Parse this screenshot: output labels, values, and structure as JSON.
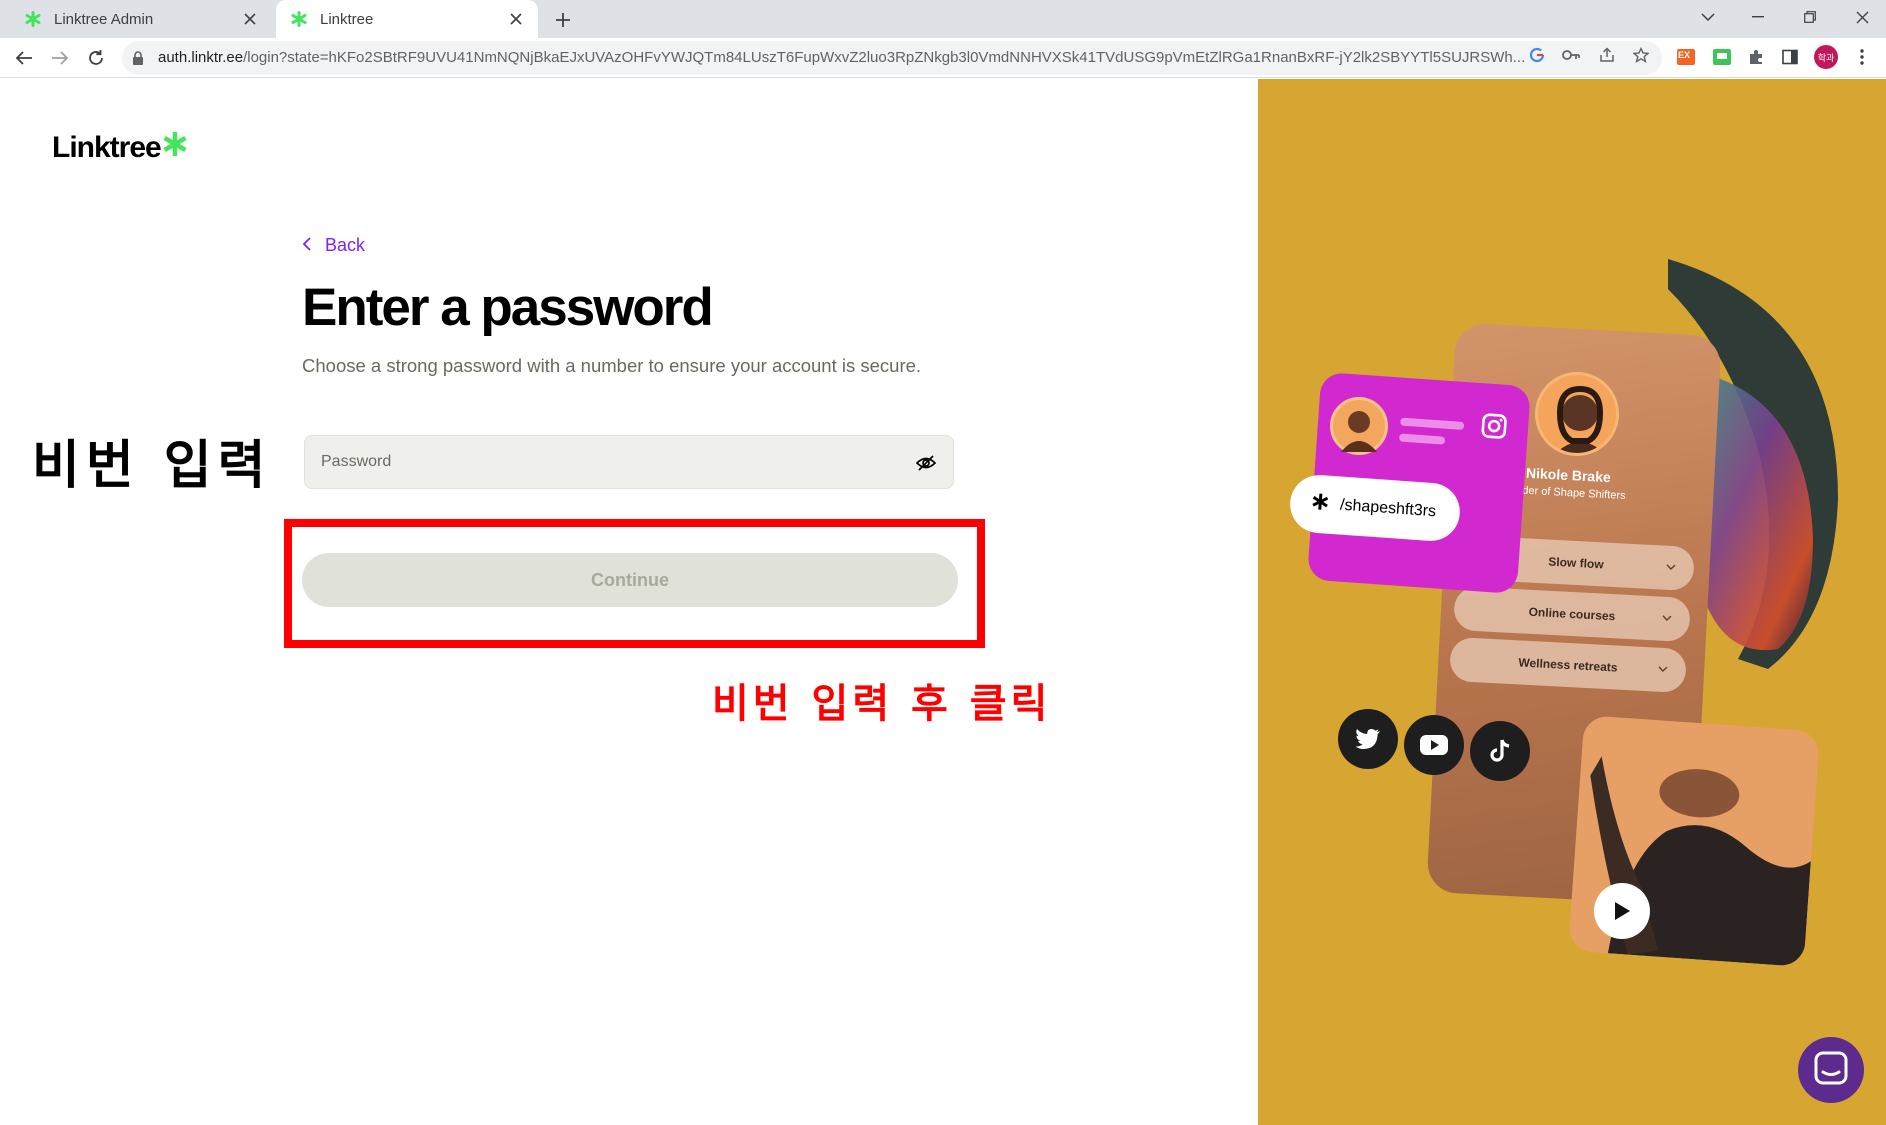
{
  "browser": {
    "tabs": [
      {
        "title": "Linktree Admin",
        "active": false
      },
      {
        "title": "Linktree",
        "active": true
      }
    ],
    "url_host": "auth.linktr.ee",
    "url_rest": "/login?state=hKFo2SBtRF9UVU41NmNQNjBkaEJxUVAzOHFvYWJQTm84LUszT6FupWxvZ2luo3RpZNkgb3l0VmdNNHVXSk41TVdUSG9pVmEtZlRGa1RnanBxRF-jY2lk2SBYYTl5SUJRSWh...",
    "profile_label": "학과",
    "ext_label": "EX"
  },
  "page": {
    "logo_text": "Linktree",
    "back_label": "Back",
    "heading": "Enter a password",
    "subtext": "Choose a strong password with a number to ensure your account is secure.",
    "password_placeholder": "Password",
    "continue_label": "Continue"
  },
  "annotations": {
    "left_note": "비번 입력",
    "red_note": "비번 입력 후 클릭"
  },
  "illustration": {
    "profile_name": "Nikole Brake",
    "profile_tagline": "under of Shape Shifters",
    "handle": "/shapeshft3rs",
    "links": [
      "Slow flow",
      "Online courses",
      "Wellness retreats"
    ]
  },
  "colors": {
    "accent_purple": "#7f22fe",
    "panel_mustard": "#d7a531",
    "annotation_red": "#ff0000",
    "logo_green": "#43e55e"
  }
}
